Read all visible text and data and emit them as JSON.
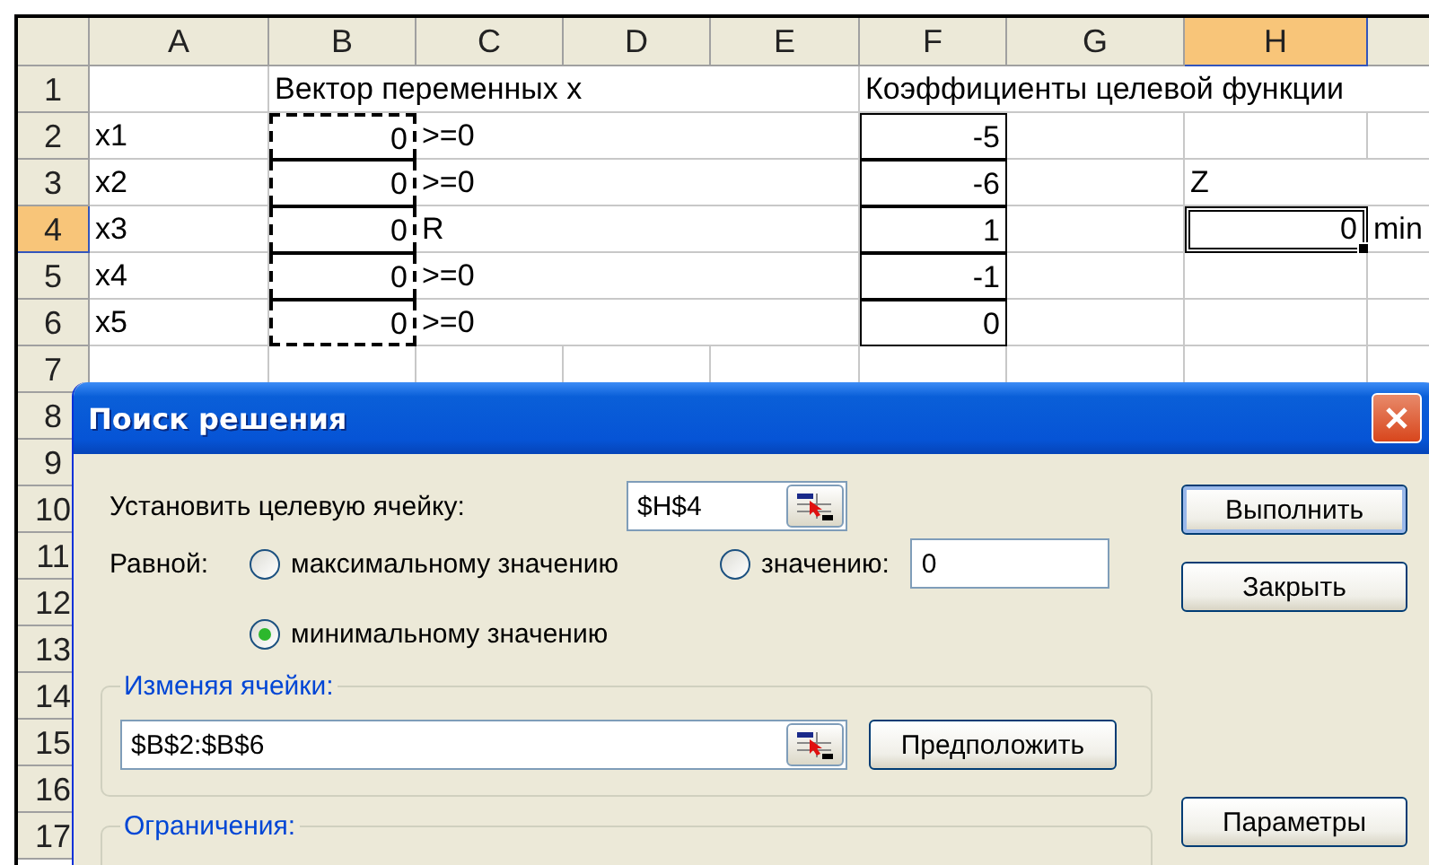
{
  "sheet": {
    "columns": [
      {
        "label": "A",
        "selected": false
      },
      {
        "label": "B",
        "selected": false
      },
      {
        "label": "C",
        "selected": false
      },
      {
        "label": "D",
        "selected": false
      },
      {
        "label": "E",
        "selected": false
      },
      {
        "label": "F",
        "selected": false
      },
      {
        "label": "G",
        "selected": false
      },
      {
        "label": "H",
        "selected": true
      }
    ],
    "rows": [
      {
        "label": "1",
        "selected": false,
        "cells": [
          {},
          {
            "text": "Вектор переменных x"
          },
          {},
          {},
          {},
          {
            "text": "Коэффициенты целевой функции"
          }
        ]
      },
      {
        "label": "2",
        "selected": false,
        "cells": [
          {
            "text": "x1"
          },
          {
            "text": "0",
            "kind": "number",
            "outlined": true,
            "marquee": true
          },
          {
            "text": ">=0"
          },
          {},
          {},
          {
            "text": "-5",
            "kind": "number",
            "outlined": true
          }
        ]
      },
      {
        "label": "3",
        "selected": false,
        "cells": [
          {
            "text": "x2"
          },
          {
            "text": "0",
            "kind": "number",
            "outlined": true,
            "marquee": true
          },
          {
            "text": ">=0"
          },
          {},
          {},
          {
            "text": "-6",
            "kind": "number",
            "outlined": true
          },
          {},
          {
            "text": "Z"
          }
        ]
      },
      {
        "label": "4",
        "selected": true,
        "cells": [
          {
            "text": "x3"
          },
          {
            "text": "0",
            "kind": "number",
            "outlined": true,
            "marquee": true
          },
          {
            "text": "R"
          },
          {},
          {},
          {
            "text": "1",
            "kind": "number",
            "outlined": true
          },
          {},
          {
            "text": "0",
            "kind": "number",
            "selected": true
          },
          {
            "text": "min"
          }
        ]
      },
      {
        "label": "5",
        "selected": false,
        "cells": [
          {
            "text": "x4"
          },
          {
            "text": "0",
            "kind": "number",
            "outlined": true,
            "marquee": true
          },
          {
            "text": ">=0"
          },
          {},
          {},
          {
            "text": "-1",
            "kind": "number",
            "outlined": true
          }
        ]
      },
      {
        "label": "6",
        "selected": false,
        "cells": [
          {
            "text": "x5"
          },
          {
            "text": "0",
            "kind": "number",
            "outlined": true,
            "marquee": true
          },
          {
            "text": ">=0"
          },
          {},
          {},
          {
            "text": "0",
            "kind": "number",
            "outlined": true
          }
        ]
      },
      {
        "label": "7",
        "selected": false
      },
      {
        "label": "8",
        "selected": false
      },
      {
        "label": "9",
        "selected": false
      },
      {
        "label": "10",
        "selected": false
      },
      {
        "label": "11",
        "selected": false
      },
      {
        "label": "12",
        "selected": false
      },
      {
        "label": "13",
        "selected": false
      },
      {
        "label": "14",
        "selected": false
      },
      {
        "label": "15",
        "selected": false
      },
      {
        "label": "16",
        "selected": false
      },
      {
        "label": "17",
        "selected": false
      }
    ]
  },
  "dialog": {
    "title": "Поиск решения",
    "target": {
      "label": "Установить целевую ячейку:",
      "value": "$H$4"
    },
    "equal_to": {
      "label": "Равной:",
      "options": [
        {
          "label": "максимальному значению",
          "selected": false
        },
        {
          "label": "значению:",
          "selected": false,
          "value": "0"
        },
        {
          "label": "минимальному значению",
          "selected": true
        }
      ]
    },
    "changing_cells": {
      "label": "Изменяя ячейки:",
      "value": "$B$2:$B$6",
      "button": "Предположить"
    },
    "constraints": {
      "label": "Ограничения:"
    },
    "buttons": [
      "Выполнить",
      "Закрыть",
      "Параметры"
    ]
  }
}
